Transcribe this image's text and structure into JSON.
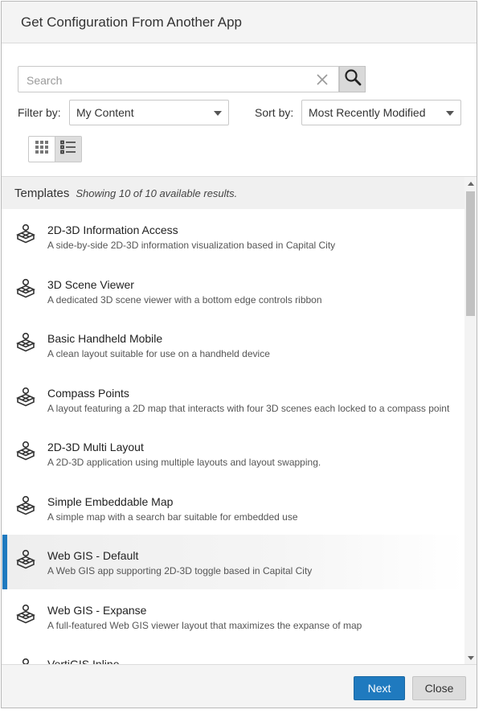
{
  "dialog": {
    "title": "Get Configuration From Another App"
  },
  "search": {
    "placeholder": "Search",
    "value": ""
  },
  "filter": {
    "label": "Filter by:",
    "value": "My Content"
  },
  "sort": {
    "label": "Sort by:",
    "value": "Most Recently Modified"
  },
  "view_toggle": {
    "active": "list"
  },
  "results": {
    "title": "Templates",
    "count_text": "Showing 10 of 10 available results.",
    "selected_index": 6,
    "items": [
      {
        "title": "2D-3D Information Access",
        "description": "A side-by-side 2D-3D information visualization based in Capital City"
      },
      {
        "title": "3D Scene Viewer",
        "description": "A dedicated 3D scene viewer with a bottom edge controls ribbon"
      },
      {
        "title": "Basic Handheld Mobile",
        "description": "A clean layout suitable for use on a handheld device"
      },
      {
        "title": "Compass Points",
        "description": "A layout featuring a 2D map that interacts with four 3D scenes each locked to a compass point"
      },
      {
        "title": "2D-3D Multi Layout",
        "description": "A 2D-3D application using multiple layouts and layout swapping."
      },
      {
        "title": "Simple Embeddable Map",
        "description": "A simple map with a search bar suitable for embedded use"
      },
      {
        "title": "Web GIS - Default",
        "description": "A Web GIS app supporting 2D-3D toggle based in Capital City"
      },
      {
        "title": "Web GIS - Expanse",
        "description": "A full-featured Web GIS viewer layout that maximizes the expanse of map"
      },
      {
        "title": "VertiGIS Inline",
        "description": ""
      }
    ]
  },
  "footer": {
    "next_label": "Next",
    "close_label": "Close"
  },
  "colors": {
    "primary": "#1f7abf",
    "selected_bar": "#1f7abf"
  }
}
